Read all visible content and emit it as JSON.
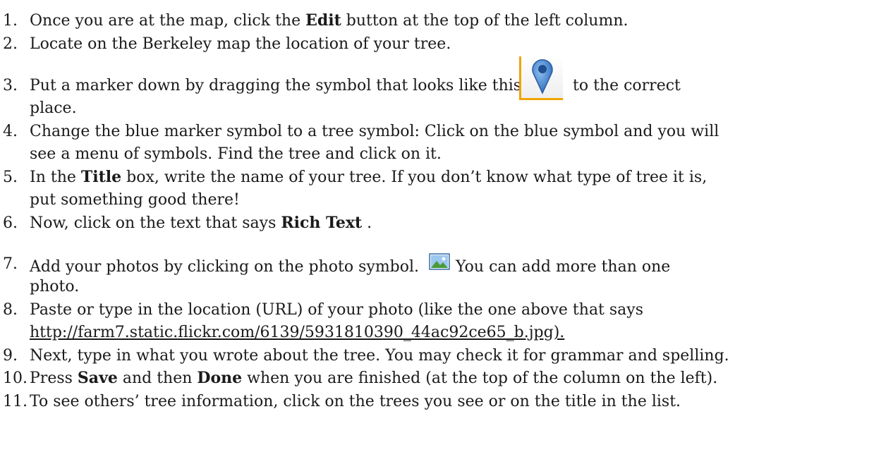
{
  "steps": [
    {
      "num": "1.",
      "pre": "Once you are at the map, click the ",
      "bold": "Edit",
      "post": " button at the top of the left column."
    },
    {
      "num": "2.",
      "text": "Locate on the Berkeley map the location of your tree."
    },
    {
      "num": "3.",
      "pre": "Put a marker down by dragging the symbol that looks like this: ",
      "post": " to the correct",
      "cont": "place."
    },
    {
      "num": "4.",
      "text": "Change the blue marker symbol to a tree symbol:  Click on the blue symbol and you will",
      "cont": "see a menu of symbols. Find the tree and click on it."
    },
    {
      "num": "5.",
      "pre": "In the ",
      "bold": "Title",
      "post": " box, write the name of your tree. If you don’t know what type of tree it is,",
      "cont": "put something good there!"
    },
    {
      "num": "6.",
      "pre": "Now, click on the text that says ",
      "bold": "Rich Text",
      "post": " ."
    },
    {
      "num": "7.",
      "pre": "Add your photos by clicking on the photo symbol.",
      "post": "You can add more than one",
      "cont": "photo."
    },
    {
      "num": "8.",
      "text": "Paste or type in the location (URL) of your photo (like the one above that says",
      "cont": "http://farm7.static.flickr.com/6139/5931810390_44ac92ce65_b.jpg)."
    },
    {
      "num": "9.",
      "text": "Next, type in what you wrote about the tree. You may check it for grammar and spelling."
    },
    {
      "num": "10.",
      "pre": "Press ",
      "bold": "Save",
      "mid": " and then ",
      "bold2": "Done",
      "post": " when you are finished (at the top of the column on the left)."
    },
    {
      "num": "11.",
      "text": "To see others’ tree information, click on the trees you see or on the title in the list."
    }
  ],
  "icons": {
    "marker": "map-marker-icon",
    "photo": "photo-icon"
  },
  "colors": {
    "marker_blue": "#3b78c4",
    "marker_bracket": "#f0a400"
  }
}
